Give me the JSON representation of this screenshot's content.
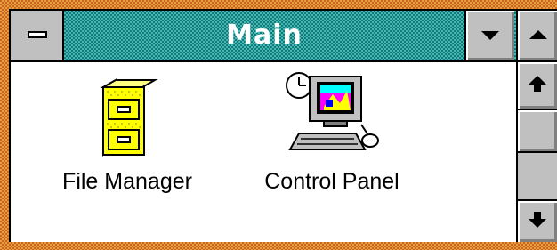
{
  "window": {
    "title": "Main"
  },
  "icons": [
    {
      "label": "File Manager",
      "icon": "file-cabinet-icon"
    },
    {
      "label": "Control Panel",
      "icon": "computer-clock-icon"
    }
  ],
  "colors": {
    "titlebar": "#0f7a78",
    "frame": "#c8641e",
    "chrome": "#c0c0c0"
  }
}
